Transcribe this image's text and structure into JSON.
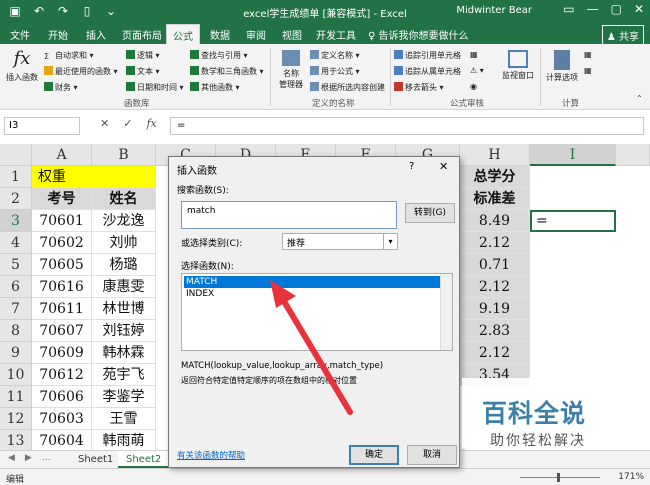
{
  "window": {
    "title": "excel学生成绩单 [兼容模式] - Excel",
    "user": "Midwinter Bear"
  },
  "tabs": [
    "文件",
    "开始",
    "插入",
    "页面布局",
    "公式",
    "数据",
    "审阅",
    "视图",
    "开发工具"
  ],
  "active_tab": "公式",
  "tellme": "告诉我你想要做什么",
  "share": "共享",
  "ribbon": {
    "insert_function": "插入函数",
    "autosum": "自动求和",
    "recent": "最近使用的函数",
    "finance": "财务",
    "logic": "逻辑",
    "text": "文本",
    "datetime": "日期和时间",
    "lookup": "查找与引用",
    "math": "数学和三角函数",
    "other": "其他函数",
    "function_library": "函数库",
    "name_manager": "名称\n管理器",
    "define_name": "定义名称",
    "use_in_formula": "用于公式",
    "create_from_sel": "根据所选内容创建",
    "defined_names": "定义的名称",
    "trace_precedents": "追踪引用单元格",
    "trace_dependents": "追踪从属单元格",
    "remove_arrows": "移去箭头",
    "formula_auditing": "公式审核",
    "watch_window": "监视窗口",
    "calc_options": "计算选项",
    "calculation": "计算"
  },
  "formula_bar": {
    "name_box": "I3",
    "formula": "="
  },
  "grid": {
    "columns": [
      "A",
      "B",
      "C",
      "D",
      "E",
      "F",
      "G",
      "H",
      "I"
    ],
    "rows": [
      "1",
      "2",
      "3",
      "4",
      "5",
      "6",
      "7",
      "8",
      "9",
      "10",
      "11",
      "12",
      "13"
    ],
    "row1_label": "权重",
    "header_a": "考号",
    "header_b": "姓名",
    "header_h1": "总学分",
    "header_h2": "标准差",
    "i3": "=",
    "records": [
      {
        "id": "70601",
        "name": "沙龙逸",
        "std": "8.49"
      },
      {
        "id": "70602",
        "name": "刘帅",
        "std": "2.12"
      },
      {
        "id": "70605",
        "name": "杨璐",
        "std": "0.71"
      },
      {
        "id": "70616",
        "name": "康惠雯",
        "std": "2.12"
      },
      {
        "id": "70611",
        "name": "林世博",
        "std": "9.19"
      },
      {
        "id": "70607",
        "name": "刘钰婷",
        "std": "2.83"
      },
      {
        "id": "70609",
        "name": "韩林霖",
        "std": "2.12"
      },
      {
        "id": "70612",
        "name": "苑宇飞",
        "std": "3.54"
      },
      {
        "id": "70606",
        "name": "李鉴学",
        "std": ""
      },
      {
        "id": "70603",
        "name": "王雪",
        "std": ""
      },
      {
        "id": "70604",
        "name": "韩雨萌",
        "std": ""
      }
    ]
  },
  "dialog": {
    "title": "插入函数",
    "help": "?",
    "close": "✕",
    "search_label": "搜索函数(S):",
    "search_value": "match",
    "go_button": "转到(G)",
    "category_label": "或选择类别(C):",
    "category_value": "推荐",
    "select_label": "选择函数(N):",
    "functions": [
      "MATCH",
      "INDEX"
    ],
    "syntax": "MATCH(lookup_value,lookup_array,match_type)",
    "description": "返回符合特定值特定顺序的项在数组中的相对位置",
    "help_link": "有关该函数的帮助",
    "ok": "确定",
    "cancel": "取消"
  },
  "sheets": [
    "Sheet1",
    "Sheet2"
  ],
  "status": {
    "ready": "编辑",
    "zoom": "171%"
  },
  "watermark": {
    "main": "百科全说",
    "sub": "助你轻松解决"
  },
  "colors": {
    "excel_green": "#217346",
    "yellow": "#ffff00",
    "selection": "#0078d7",
    "arrow": "#e8333a"
  }
}
